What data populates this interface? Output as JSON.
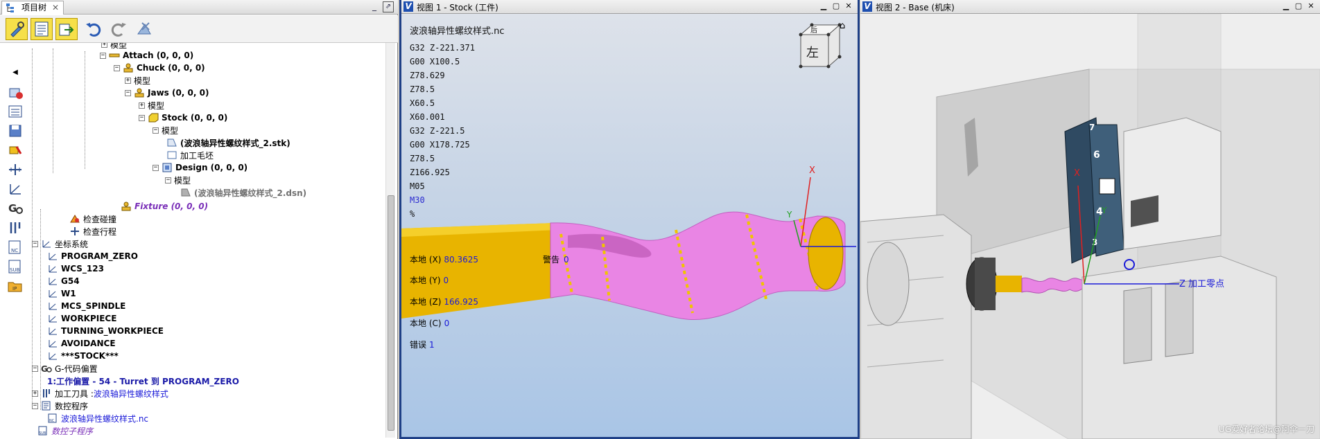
{
  "tree_pane": {
    "tab_label": "项目树",
    "tab_icon": "project-tree-icon",
    "close_glyph": "✕",
    "min_glyph": "_",
    "max_glyph": "⇗"
  },
  "toolbar": {
    "buttons": [
      {
        "name": "configure-component-button",
        "icon": "wrench-pencil-icon",
        "highlighted": true
      },
      {
        "name": "properties-button",
        "icon": "properties-icon",
        "highlighted": true
      },
      {
        "name": "export-button",
        "icon": "export-icon",
        "highlighted": true
      },
      {
        "name": "undo-button",
        "icon": "undo-icon",
        "highlighted": false
      },
      {
        "name": "redo-button",
        "icon": "redo-icon",
        "highlighted": false
      },
      {
        "name": "delete-button",
        "icon": "delete-icon",
        "highlighted": false
      }
    ]
  },
  "rail": {
    "collapse_glyph": "◀",
    "items": [
      "add-component-icon",
      "list-icon",
      "save-icon",
      "color-icon",
      "axis-icon",
      "coordinate-system-icon",
      "g-code-icon",
      "tool-icon",
      "nc-program-icon",
      "sub-program-icon",
      "ip-icon"
    ]
  },
  "tree": {
    "n_model0": "模型",
    "n_attach": "Attach (0, 0, 0)",
    "n_chuck": "Chuck (0, 0, 0)",
    "n_model1": "模型",
    "n_jaws": "Jaws (0, 0, 0)",
    "n_model2": "模型",
    "n_stock": "Stock (0, 0, 0)",
    "n_model3": "模型",
    "n_stk": "(波浪轴异性螺纹样式_2.stk)",
    "n_blank": "加工毛坯",
    "n_design": "Design (0, 0, 0)",
    "n_model4": "模型",
    "n_dsn": "(波浪轴异性螺纹样式_2.dsn)",
    "n_fixture": "Fixture (0, 0, 0)",
    "n_collision": "检查碰撞",
    "n_travel": "检查行程",
    "n_coordsys": "坐标系统",
    "n_prog_zero": "PROGRAM_ZERO",
    "n_wcs123": "WCS_123",
    "n_g54": "G54",
    "n_w1": "W1",
    "n_mcs": "MCS_SPINDLE",
    "n_workpiece": "WORKPIECE",
    "n_turning": "TURNING_WORKPIECE",
    "n_avoid": "AVOIDANCE",
    "n_stockstar": "***STOCK***",
    "n_gcode_offset": "G-代码偏置",
    "n_work_offset": "1:工作偏置 - 54 - Turret 到 PROGRAM_ZERO",
    "n_tool_label": "加工刀具 : ",
    "n_tool_value": "波浪轴异性螺纹样式",
    "n_ncprog": "数控程序",
    "n_ncfile": "波浪轴异性螺纹样式.nc",
    "n_subprog": "数控子程序"
  },
  "view1": {
    "title": "视图 1 - Stock (工件)",
    "nc_file": "波浪轴异性螺纹样式.nc",
    "gcode_lines": [
      "G32 Z-221.371",
      "G00 X100.5",
      "Z78.629",
      "Z78.5",
      "X60.5",
      "X60.001",
      "G32 Z-221.5",
      "G00 X178.725",
      "Z78.5",
      "Z166.925",
      "M05",
      "M30",
      "%"
    ],
    "highlight_index": 11,
    "local_x_label": "本地 (X)",
    "local_x": "80.3625",
    "local_y_label": "本地 (Y)",
    "local_y": "0",
    "local_z_label": "本地 (Z)",
    "local_z": "166.925",
    "local_c_label": "本地 (C)",
    "local_c": "0",
    "warn_label": "警告",
    "warn_value": "0",
    "error_label": "错误",
    "error_value": "1",
    "viewcube_top": "后",
    "viewcube_front": "左",
    "axis_x": "X",
    "axis_y": "Y",
    "colors": {
      "stock": "#e985e4",
      "thread": "#f0c400",
      "frame": "#1e3f86"
    }
  },
  "view2": {
    "title": "视图 2 - Base (机床)",
    "axis_x": "X",
    "axis_y": "Y",
    "axis_z_label": "Z 加工零点",
    "turret_numbers": [
      "7",
      "6",
      "4",
      "3"
    ],
    "watermark": "UG爱好者论坛@阿伞一刀"
  },
  "window_controls": {
    "min": "▁",
    "max": "▢",
    "close": "✕"
  }
}
